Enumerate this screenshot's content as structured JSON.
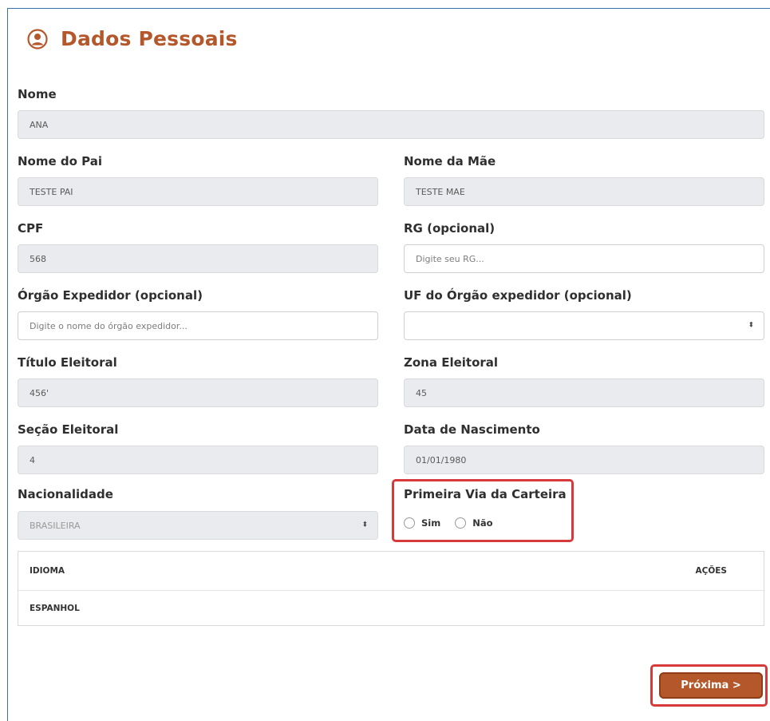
{
  "page": {
    "title": "Dados Pessoais",
    "title_icon": "user-circle-icon",
    "accent_color": "#b4582b",
    "highlight_color": "#d63a3a"
  },
  "form": {
    "nome": {
      "label": "Nome",
      "value": "ANA"
    },
    "nome_pai": {
      "label": "Nome do Pai",
      "value": "TESTE PAI"
    },
    "nome_mae": {
      "label": "Nome da Mãe",
      "value": "TESTE MAE"
    },
    "cpf": {
      "label": "CPF",
      "value": "568"
    },
    "rg": {
      "label": "RG (opcional)",
      "placeholder": "Digite seu RG..."
    },
    "orgao_expedidor": {
      "label": "Órgão Expedidor (opcional)",
      "placeholder": "Digite o nome do órgão expedidor..."
    },
    "uf_orgao": {
      "label": "UF do Órgão expedidor (opcional)",
      "value": "",
      "arrow": "⬍"
    },
    "titulo_eleitoral": {
      "label": "Título Eleitoral",
      "value": "456'"
    },
    "zona_eleitoral": {
      "label": "Zona Eleitoral",
      "value": "45"
    },
    "secao_eleitoral": {
      "label": "Seção Eleitoral",
      "value": "4"
    },
    "data_nascimento": {
      "label": "Data de Nascimento",
      "value": "01/01/1980"
    },
    "nacionalidade": {
      "label": "Nacionalidade",
      "value": "BRASILEIRA",
      "arrow": "⬍"
    },
    "primeira_via": {
      "label": "Primeira Via da Carteira",
      "options": [
        "Sim",
        "Não"
      ]
    }
  },
  "idiomas_table": {
    "headers": [
      "IDIOMA",
      "AÇÕES"
    ],
    "rows": [
      [
        "ESPANHOL",
        ""
      ]
    ]
  },
  "actions": {
    "next_label": "Próxima >"
  }
}
